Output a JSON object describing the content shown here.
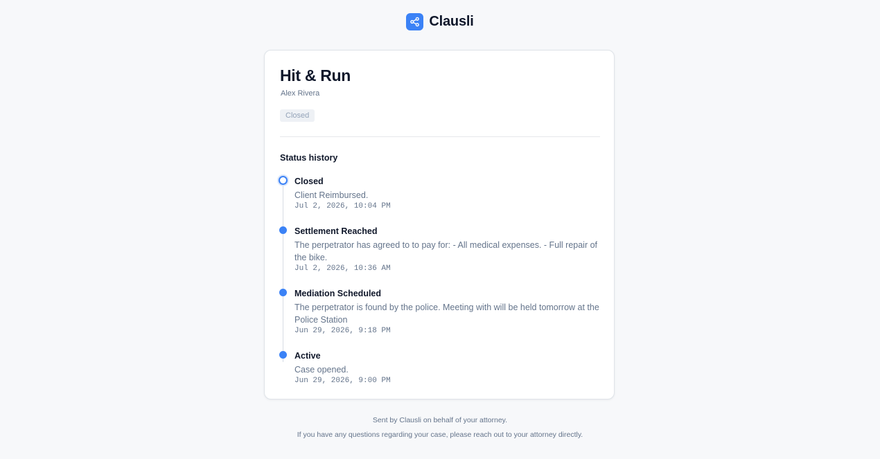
{
  "brand": {
    "name": "Clausli",
    "icon": "share-icon",
    "accent_color": "#3b82f6"
  },
  "case": {
    "title": "Hit & Run",
    "client": "Alex Rivera",
    "status": "Closed"
  },
  "history": {
    "heading": "Status history",
    "entries": [
      {
        "status": "Closed",
        "note": "Client Reimbursed.",
        "timestamp": "Jul 2, 2026, 10:04 PM"
      },
      {
        "status": "Settlement Reached",
        "note": "The perpetrator has agreed to to pay for: - All medical expenses. - Full repair of the bike.",
        "timestamp": "Jul 2, 2026, 10:36 AM"
      },
      {
        "status": "Mediation Scheduled",
        "note": "The perpetrator is found by the police. Meeting with will be held tomorrow at the Police Station",
        "timestamp": "Jun 29, 2026, 9:18 PM"
      },
      {
        "status": "Active",
        "note": "Case opened.",
        "timestamp": "Jun 29, 2026, 9:00 PM"
      }
    ]
  },
  "footer": {
    "line1": "Sent by Clausli on behalf of your attorney.",
    "line2": "If you have any questions regarding your case, please reach out to your attorney directly."
  }
}
